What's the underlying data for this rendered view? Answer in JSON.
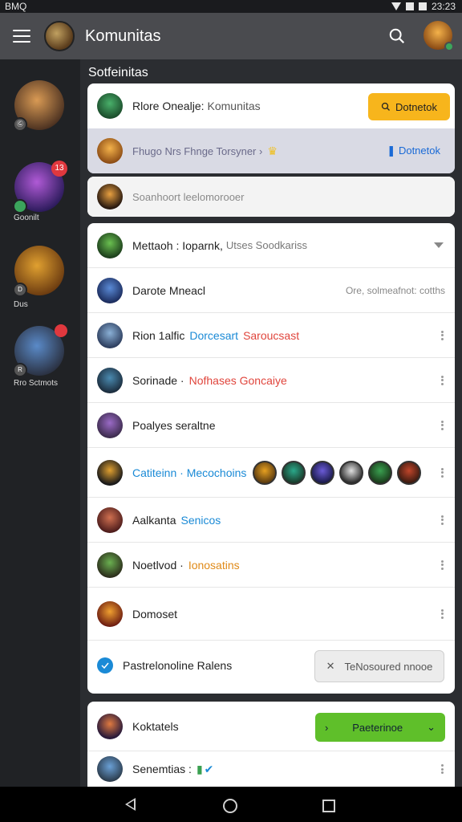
{
  "status": {
    "left": "BMQ",
    "time": "23:23"
  },
  "appbar": {
    "title": "Komunitas"
  },
  "rail": {
    "items": [
      {
        "label": "",
        "badge": "",
        "dot": "Ⓖ",
        "color1": "#d99a54",
        "color2": "#4a3020"
      },
      {
        "label": "Goonilt",
        "badge": "13",
        "dot": "",
        "color1": "#b05ad6",
        "color2": "#2a1a5a"
      },
      {
        "label": "Dus",
        "badge": "",
        "dot": "D",
        "color1": "#e0a030",
        "color2": "#6a3a10"
      },
      {
        "label": "Rro Sctmots",
        "badge": "",
        "dot": "R",
        "color1": "#5a8ac8",
        "color2": "#2a3040"
      }
    ]
  },
  "main": {
    "section_title": "Sotfeinitas",
    "top_card": {
      "name_label": "Rlore Onealje:",
      "community_label": "Komunitas",
      "button_label": "Dotnetok"
    },
    "highlight_row": {
      "text": "Fhugo Nrs Fhnge Torsyner ›",
      "button_label": "Dotnetok"
    },
    "search": {
      "placeholder": "Soanhoort leelomorooer"
    },
    "list": {
      "header": {
        "title": "Mettaoh : Ioparnk,",
        "sub": "Utses Soodkariss"
      },
      "rows": [
        {
          "name": "Darote Mneacl",
          "extra": "Ore, solmeafnot: cotths",
          "extra_color": "grey"
        },
        {
          "name": "Rion 1alfic",
          "tag1": "Dorcesart",
          "tag2": "Saroucsast"
        },
        {
          "name": "Sorinade ·",
          "tag2": "Nofhases Goncaiye"
        },
        {
          "name": "Poalyes seraltne"
        },
        {
          "name": "",
          "tag1": "Catiteinn · Mecochoins",
          "avatars": [
            "#e6a020",
            "#2aa88a",
            "#6a5ad6",
            "#e0e0e0",
            "#3aa050",
            "#c0452a"
          ]
        },
        {
          "name": "Aalkanta",
          "tag1": "Senicos"
        },
        {
          "name": "Noetlvod ·",
          "tag3": "Ionosatins"
        },
        {
          "name": "Domoset"
        }
      ],
      "checkbox_row": {
        "label": "Pastrelonoline Ralens",
        "button_label": "TeNosoured nnooe"
      }
    },
    "bottom_card": {
      "row1": {
        "name": "Koktatels",
        "button_label": "Paeterinoe"
      },
      "row2": {
        "name": "Senemtias :"
      }
    }
  }
}
